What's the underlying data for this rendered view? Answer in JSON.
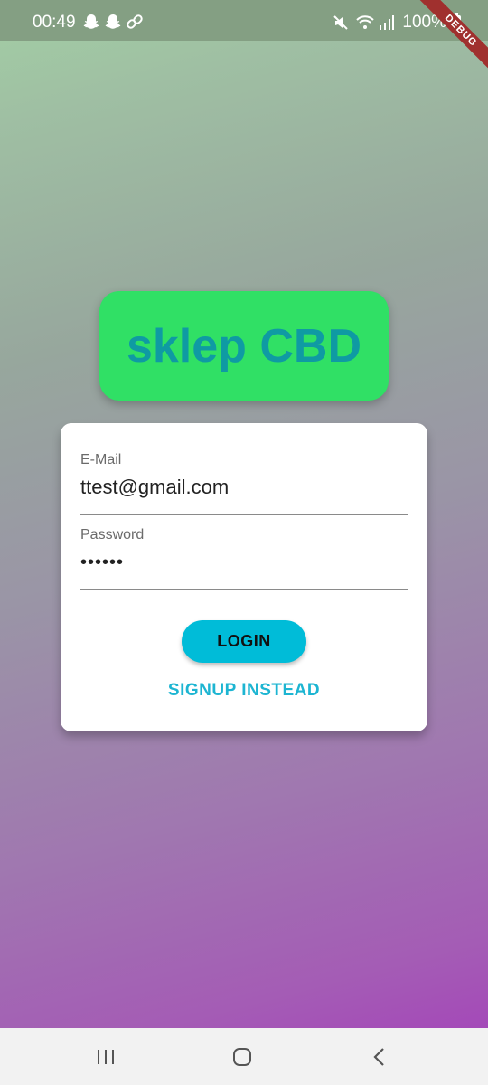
{
  "status_bar": {
    "time": "00:49",
    "left_icons": [
      "snapchat-icon",
      "snapchat-icon",
      "link-icon"
    ],
    "right_icons": [
      "mute-icon",
      "wifi-icon",
      "signal-icon"
    ],
    "battery_text": "100%"
  },
  "debug_banner": "DEBUG",
  "logo": {
    "text": "sklep CBD",
    "background_color": "#30e065",
    "text_color": "#0f9aa3"
  },
  "login_form": {
    "email": {
      "label": "E-Mail",
      "value": "ttest@gmail.com"
    },
    "password": {
      "label": "Password",
      "value": "••••••"
    },
    "login_button": "LOGIN",
    "signup_link": "SIGNUP INSTEAD",
    "accent_color": "#00bcd8"
  },
  "nav_bar": {
    "buttons": [
      "recent-apps-icon",
      "home-icon",
      "back-icon"
    ]
  }
}
